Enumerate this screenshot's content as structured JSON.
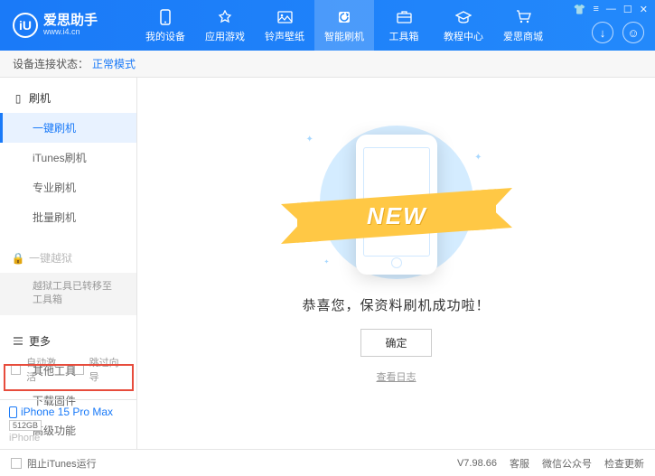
{
  "header": {
    "logo_letter": "iU",
    "app_name": "爱思助手",
    "site": "www.i4.cn",
    "nav": [
      {
        "label": "我的设备"
      },
      {
        "label": "应用游戏"
      },
      {
        "label": "铃声壁纸"
      },
      {
        "label": "智能刷机"
      },
      {
        "label": "工具箱"
      },
      {
        "label": "教程中心"
      },
      {
        "label": "爱思商城"
      }
    ]
  },
  "status": {
    "label": "设备连接状态：",
    "value": "正常模式"
  },
  "sidebar": {
    "flash": {
      "title": "刷机",
      "items": [
        "一键刷机",
        "iTunes刷机",
        "专业刷机",
        "批量刷机"
      ]
    },
    "jailbreak": {
      "title": "一键越狱",
      "note": "越狱工具已转移至\n工具箱"
    },
    "more": {
      "title": "更多",
      "items": [
        "其他工具",
        "下载固件",
        "高级功能"
      ]
    },
    "checks": {
      "auto_activate": "自动激活",
      "skip_setup": "跳过向导"
    },
    "device": {
      "name": "iPhone 15 Pro Max",
      "storage": "512GB",
      "type": "iPhone"
    }
  },
  "main": {
    "ribbon": "NEW",
    "message": "恭喜您，保资料刷机成功啦！",
    "ok": "确定",
    "log": "查看日志"
  },
  "footer": {
    "block_itunes": "阻止iTunes运行",
    "version": "V7.98.66",
    "links": [
      "客服",
      "微信公众号",
      "检查更新"
    ]
  }
}
